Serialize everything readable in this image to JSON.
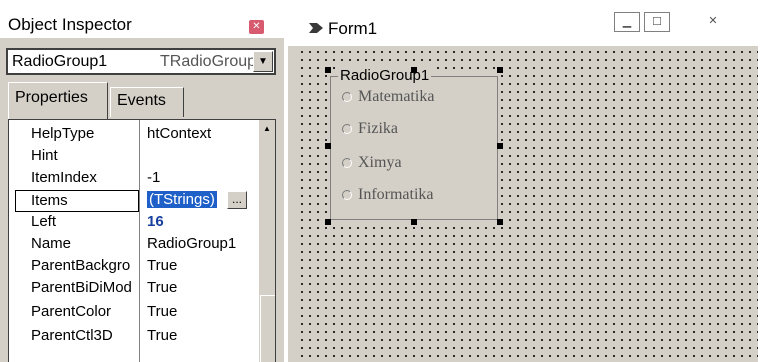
{
  "inspector": {
    "title": "Object Inspector",
    "component_name": "RadioGroup1",
    "component_type": "TRadioGroup",
    "tabs": [
      {
        "label": "Properties"
      },
      {
        "label": "Events"
      }
    ],
    "properties": [
      {
        "name": "HelpType",
        "value": "htContext"
      },
      {
        "name": "Hint",
        "value": ""
      },
      {
        "name": "ItemIndex",
        "value": "-1"
      },
      {
        "name": "Items",
        "value": "(TStrings)"
      },
      {
        "name": "Left",
        "value": "16"
      },
      {
        "name": "Name",
        "value": "RadioGroup1"
      },
      {
        "name": "ParentBackgro",
        "value": "True"
      },
      {
        "name": "ParentBiDiMod",
        "value": "True"
      },
      {
        "name": "ParentColor",
        "value": "True"
      },
      {
        "name": "ParentCtl3D",
        "value": "True"
      }
    ],
    "ellipsis_label": "...",
    "selected_value_color": "#1e60c8"
  },
  "form": {
    "title": "Form1",
    "radiogroup": {
      "caption": "RadioGroup1",
      "items": [
        "Matematika",
        "Fizika",
        "Ximya",
        "Informatika"
      ]
    }
  }
}
